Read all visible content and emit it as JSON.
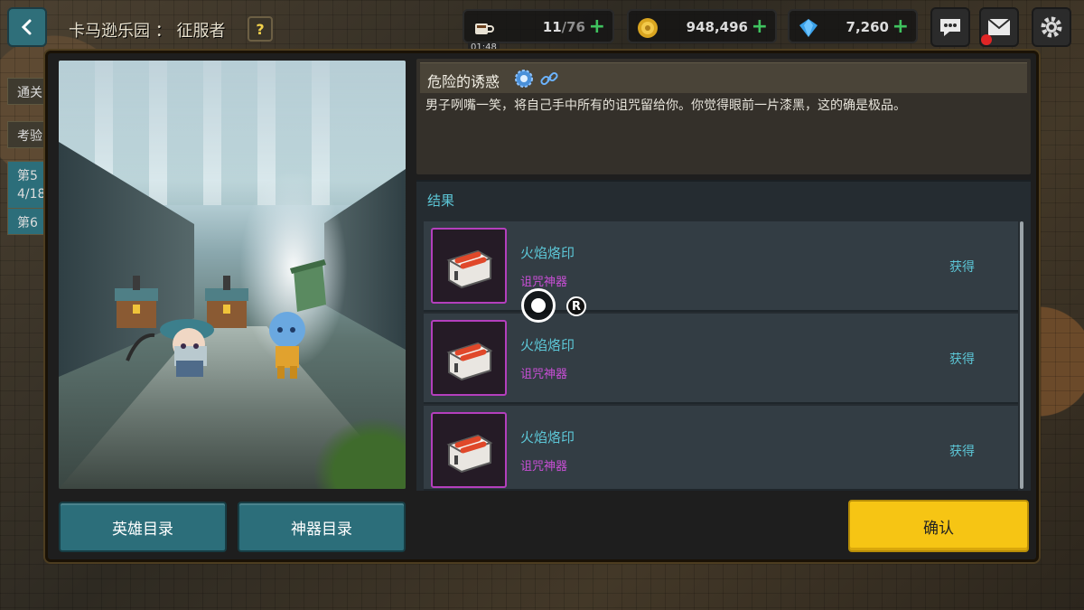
{
  "header": {
    "title": "卡马逊乐园 ： 征服者",
    "help_label": "?"
  },
  "resources": {
    "stamina": {
      "current": "11",
      "max": "/76",
      "timer": "01:48",
      "plus": "+"
    },
    "gold": {
      "value": "948,496",
      "plus": "+"
    },
    "gems": {
      "value": "7,260",
      "plus": "+"
    }
  },
  "sidebar": {
    "items": [
      "通关",
      "考验",
      "第5",
      "4/18",
      "第6"
    ]
  },
  "event": {
    "title": "危险的诱惑",
    "description": "男子咧嘴一笑，将自己手中所有的诅咒留给你。你觉得眼前一片漆黑，这的确是极品。"
  },
  "results": {
    "label": "结果",
    "items": [
      {
        "name": "火焰烙印",
        "type": "诅咒神器",
        "action": "获得"
      },
      {
        "name": "火焰烙印",
        "type": "诅咒神器",
        "action": "获得"
      },
      {
        "name": "火焰烙印",
        "type": "诅咒神器",
        "action": "获得"
      }
    ]
  },
  "buttons": {
    "hero_catalog": "英雄目录",
    "artifact_catalog": "神器目录",
    "confirm": "确认"
  },
  "overlay": {
    "record_badge": "R"
  },
  "colors": {
    "accent_teal": "#5cc6d6",
    "curse_purple": "#c94fd6",
    "confirm_yellow": "#f6c514",
    "button_teal": "#2c6e7a"
  }
}
